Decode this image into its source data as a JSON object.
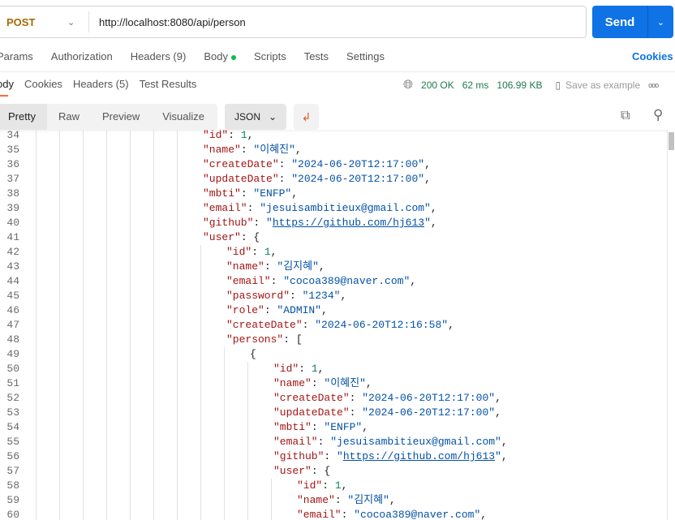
{
  "request": {
    "method": "POST",
    "url": "http://localhost:8080/api/person",
    "send": "Send"
  },
  "request_tabs": [
    "Params",
    "Authorization",
    "Headers (9)",
    "Body",
    "Scripts",
    "Tests",
    "Settings"
  ],
  "cookies_link": "Cookies",
  "response_tabs": [
    "ody",
    "Cookies",
    "Headers (5)",
    "Test Results"
  ],
  "response_meta": {
    "status": "200 OK",
    "time": "62 ms",
    "size": "106.99 KB",
    "save": "Save as example",
    "more": "ooo"
  },
  "view_modes": [
    "Pretty",
    "Raw",
    "Preview",
    "Visualize"
  ],
  "format": "JSON",
  "lines": [
    {
      "n": 34,
      "l": 7,
      "k": "id",
      "v": "1",
      "t": "n",
      "p": ","
    },
    {
      "n": 35,
      "l": 7,
      "k": "name",
      "v": "\"이혜진\"",
      "t": "s",
      "p": ","
    },
    {
      "n": 36,
      "l": 7,
      "k": "createDate",
      "v": "\"2024-06-20T12:17:00\"",
      "t": "s",
      "p": ","
    },
    {
      "n": 37,
      "l": 7,
      "k": "updateDate",
      "v": "\"2024-06-20T12:17:00\"",
      "t": "s",
      "p": ","
    },
    {
      "n": 38,
      "l": 7,
      "k": "mbti",
      "v": "\"ENFP\"",
      "t": "s",
      "p": ","
    },
    {
      "n": 39,
      "l": 7,
      "k": "email",
      "v": "\"jesuisambitieux@gmail.com\"",
      "t": "s",
      "p": ","
    },
    {
      "n": 40,
      "l": 7,
      "k": "github",
      "v": "https://github.com/hj613",
      "t": "link",
      "p": ","
    },
    {
      "n": 41,
      "l": 7,
      "k": "user",
      "v": "{",
      "t": "p",
      "p": ""
    },
    {
      "n": 42,
      "l": 8,
      "k": "id",
      "v": "1",
      "t": "n",
      "p": ","
    },
    {
      "n": 43,
      "l": 8,
      "k": "name",
      "v": "\"김지혜\"",
      "t": "s",
      "p": ","
    },
    {
      "n": 44,
      "l": 8,
      "k": "email",
      "v": "\"cocoa389@naver.com\"",
      "t": "s",
      "p": ","
    },
    {
      "n": 45,
      "l": 8,
      "k": "password",
      "v": "\"1234\"",
      "t": "s",
      "p": ","
    },
    {
      "n": 46,
      "l": 8,
      "k": "role",
      "v": "\"ADMIN\"",
      "t": "s",
      "p": ","
    },
    {
      "n": 47,
      "l": 8,
      "k": "createDate",
      "v": "\"2024-06-20T12:16:58\"",
      "t": "s",
      "p": ","
    },
    {
      "n": 48,
      "l": 8,
      "k": "persons",
      "v": "[",
      "t": "p",
      "p": ""
    },
    {
      "n": 49,
      "l": 9,
      "k": "",
      "v": "{",
      "t": "p",
      "p": ""
    },
    {
      "n": 50,
      "l": 10,
      "k": "id",
      "v": "1",
      "t": "n",
      "p": ","
    },
    {
      "n": 51,
      "l": 10,
      "k": "name",
      "v": "\"이혜진\"",
      "t": "s",
      "p": ","
    },
    {
      "n": 52,
      "l": 10,
      "k": "createDate",
      "v": "\"2024-06-20T12:17:00\"",
      "t": "s",
      "p": ","
    },
    {
      "n": 53,
      "l": 10,
      "k": "updateDate",
      "v": "\"2024-06-20T12:17:00\"",
      "t": "s",
      "p": ","
    },
    {
      "n": 54,
      "l": 10,
      "k": "mbti",
      "v": "\"ENFP\"",
      "t": "s",
      "p": ","
    },
    {
      "n": 55,
      "l": 10,
      "k": "email",
      "v": "\"jesuisambitieux@gmail.com\"",
      "t": "s",
      "p": ","
    },
    {
      "n": 56,
      "l": 10,
      "k": "github",
      "v": "https://github.com/hj613",
      "t": "link",
      "p": ","
    },
    {
      "n": 57,
      "l": 10,
      "k": "user",
      "v": "{",
      "t": "p",
      "p": ""
    },
    {
      "n": 58,
      "l": 11,
      "k": "id",
      "v": "1",
      "t": "n",
      "p": ","
    },
    {
      "n": 59,
      "l": 11,
      "k": "name",
      "v": "\"김지혜\"",
      "t": "s",
      "p": ","
    },
    {
      "n": 60,
      "l": 11,
      "k": "email",
      "v": "\"cocoa389@naver.com\"",
      "t": "s",
      "p": ","
    }
  ]
}
